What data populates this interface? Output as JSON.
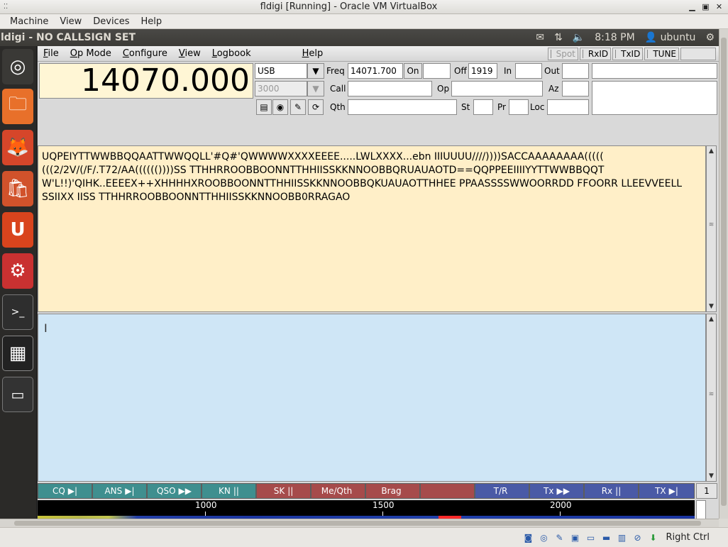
{
  "vbox": {
    "title": "fldigi [Running] - Oracle VM VirtualBox",
    "menu": [
      "Machine",
      "View",
      "Devices",
      "Help"
    ],
    "host_key": "Right Ctrl"
  },
  "panel": {
    "title": "ldigi - NO CALLSIGN SET",
    "time": "8:18 PM",
    "user": "ubuntu"
  },
  "fldigi": {
    "menu": [
      {
        "u": "F",
        "rest": "ile"
      },
      {
        "u": "O",
        "rest": "p Mode"
      },
      {
        "u": "C",
        "rest": "onfigure"
      },
      {
        "u": "V",
        "rest": "iew"
      },
      {
        "u": "L",
        "rest": "ogbook"
      },
      {
        "u": "H",
        "rest": "elp"
      }
    ],
    "toggles": [
      "Spot",
      "RxID",
      "TxID",
      "TUNE"
    ],
    "freq_display": "14070.000",
    "mode": "USB",
    "bandwidth": "3000",
    "labels": {
      "freq": "Freq",
      "on": "On",
      "off": "Off",
      "in": "In",
      "out": "Out",
      "call": "Call",
      "op": "Op",
      "az": "Az",
      "qth": "Qth",
      "st": "St",
      "pr": "Pr",
      "loc": "Loc"
    },
    "freq_value": "14071.700",
    "off_value": "1919",
    "rx_text": "UQPEIYTTWWBBQQAATTWWQQLL'#Q#'QWWWWXXXXEEEE.....LWLXXXX...ebn IIIUUUU////))))SACCAAAAAAAA((((( (((2/2V/(/F/.T72/AA(((((())))SS  TTHHRROOBBOONNTTHHIISSKKNNOOBBQRUAUAOTD==QQPPEEIIIIYYTTWWBBQQT W'L!!)'QIHK..EEEEX++XHHHHXROOBBOONNTTHHIISSKKNNOOBBQKUAUAOTTHHEE  PPAASSSSWWOORRDD FFOORR  LLEEVVEELL  SSIIXX  IISS  TTHHRROOBBOONNTTHHIISSKKNNOOBB0RRAGAO",
    "macros": [
      {
        "label": "CQ",
        "sym": "▶|",
        "color": "g"
      },
      {
        "label": "ANS",
        "sym": "▶|",
        "color": "g"
      },
      {
        "label": "QSO",
        "sym": "▶▶",
        "color": "g"
      },
      {
        "label": "KN",
        "sym": "||",
        "color": "g"
      },
      {
        "label": "SK",
        "sym": "||",
        "color": "r"
      },
      {
        "label": "Me/Qth",
        "sym": "",
        "color": "r"
      },
      {
        "label": "Brag",
        "sym": "",
        "color": "r"
      },
      {
        "label": "",
        "sym": "",
        "color": "r"
      },
      {
        "label": "T/R",
        "sym": "",
        "color": "b"
      },
      {
        "label": "Tx",
        "sym": "▶▶",
        "color": "b"
      },
      {
        "label": "Rx",
        "sym": "||",
        "color": "b"
      },
      {
        "label": "TX",
        "sym": "▶|",
        "color": "b"
      }
    ],
    "macro_set": "1",
    "scale_ticks": [
      "1000",
      "1500",
      "2000"
    ]
  }
}
